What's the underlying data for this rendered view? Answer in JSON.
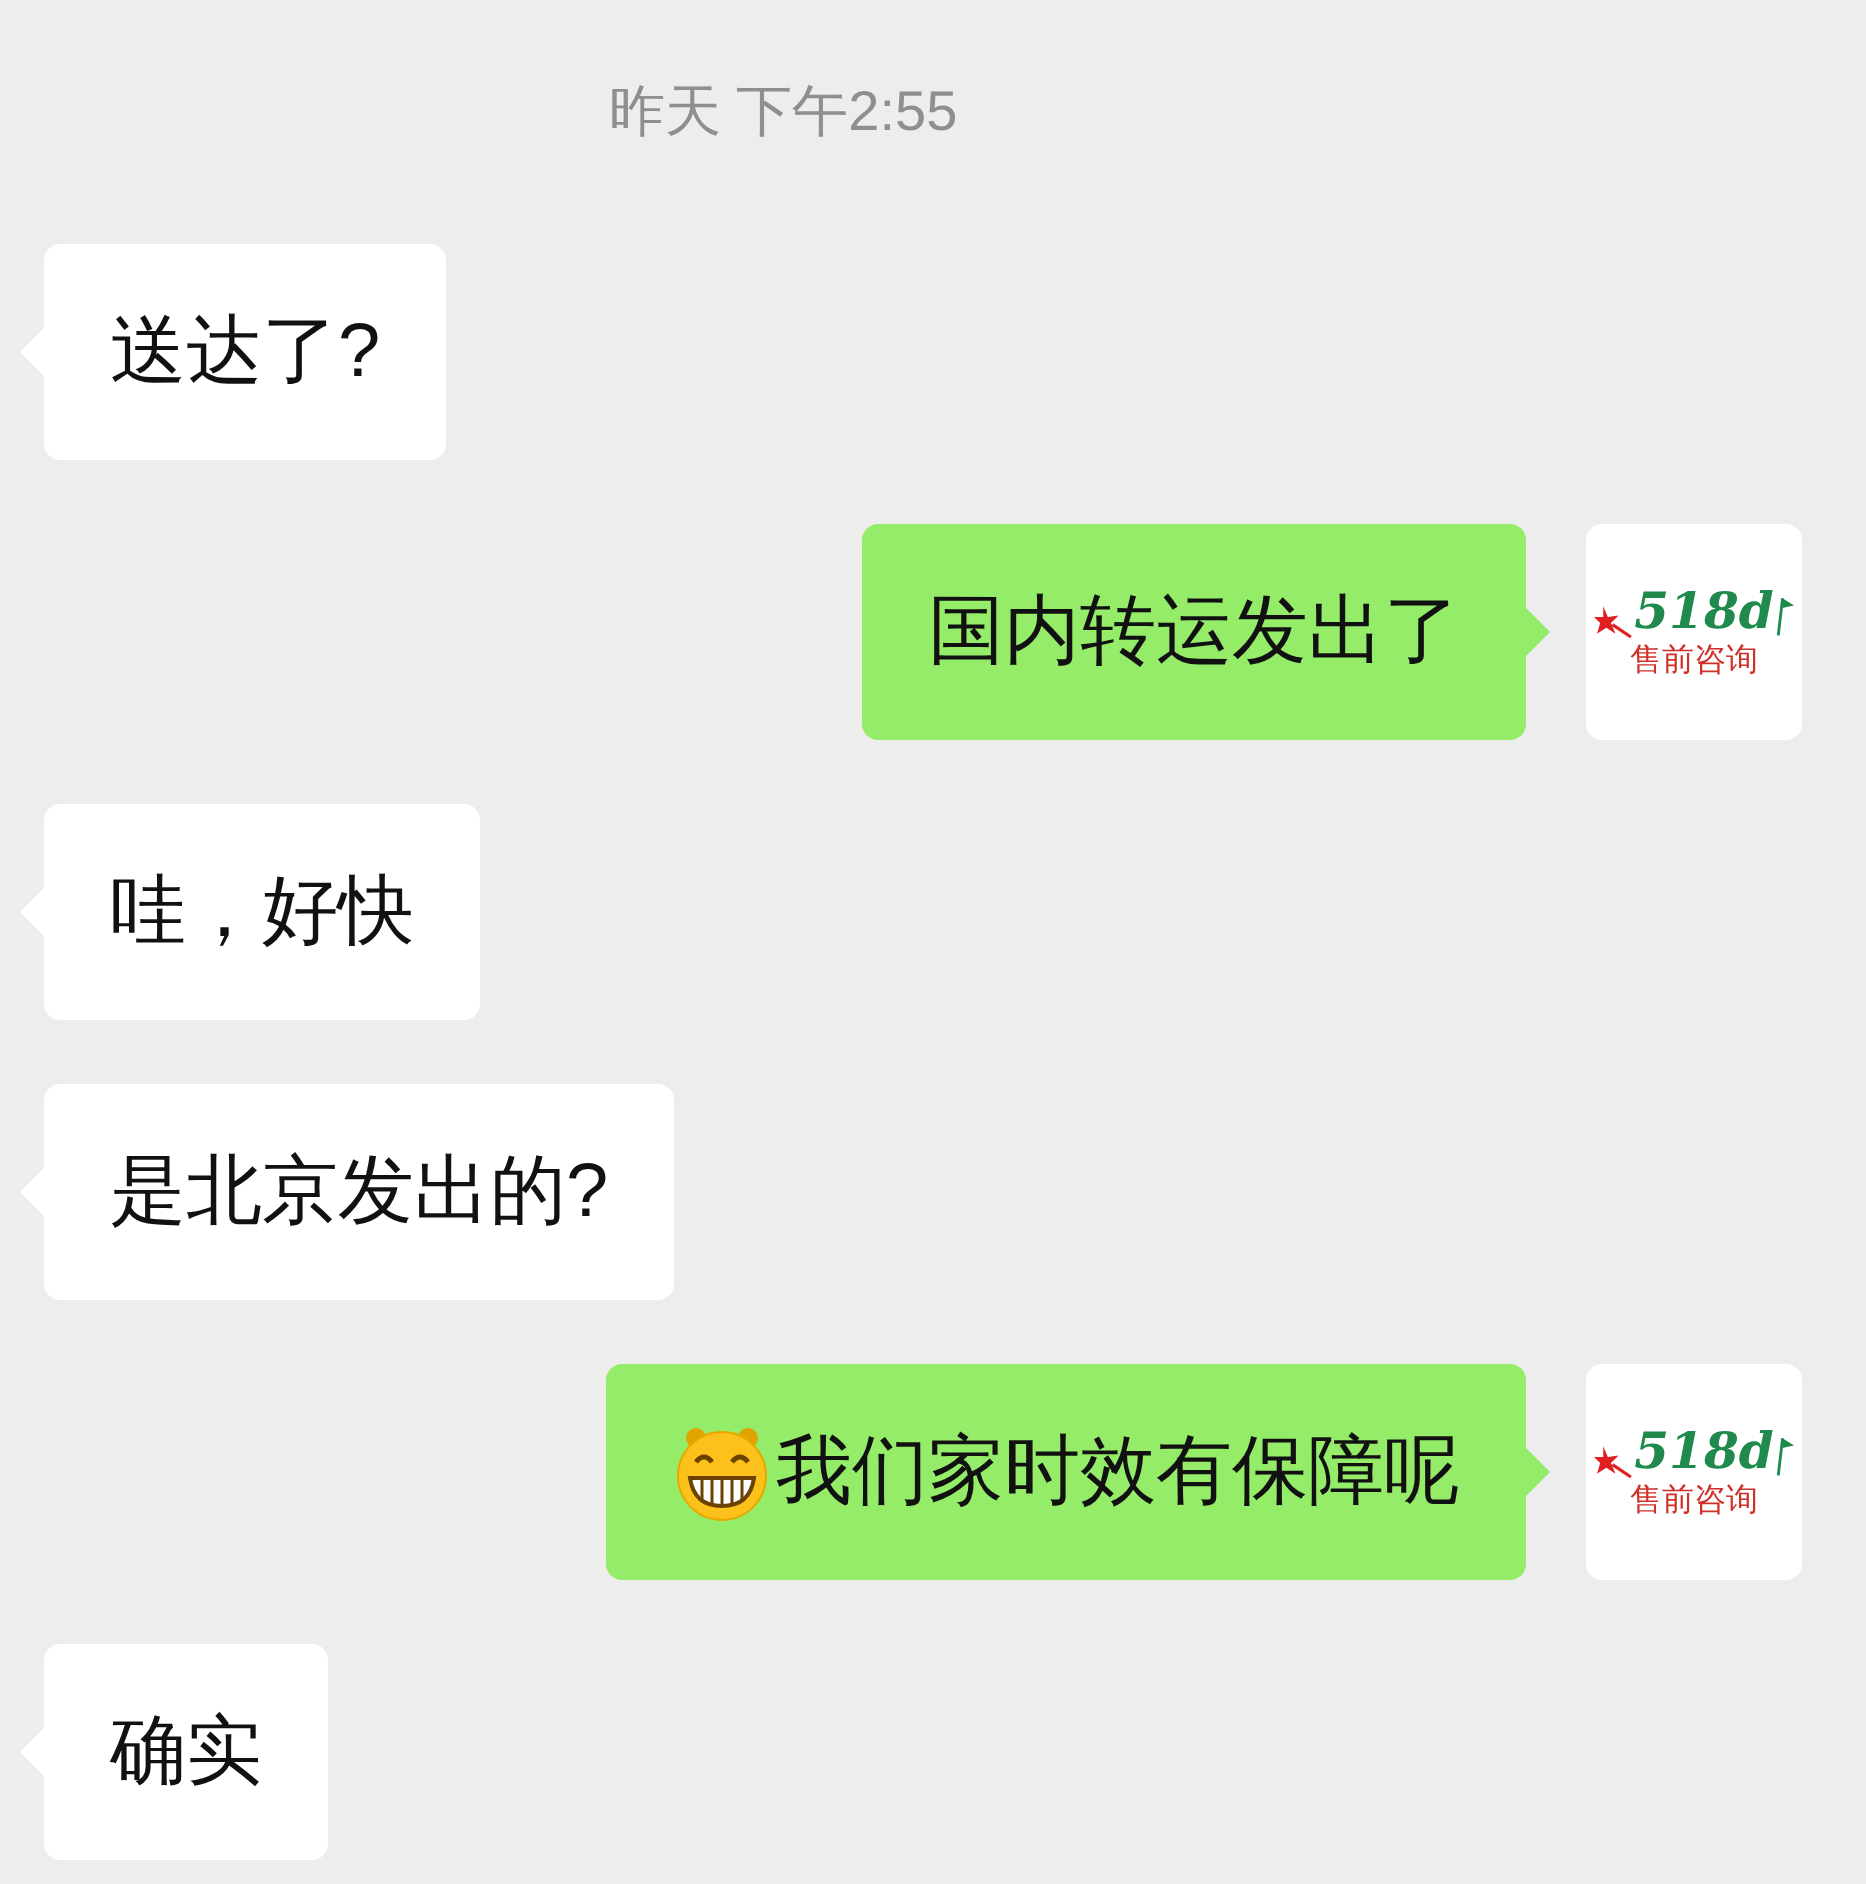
{
  "timestamp": "昨天 下午2:55",
  "messages": [
    {
      "outgoing": false,
      "kind": "text",
      "text": "送达了?"
    },
    {
      "outgoing": true,
      "kind": "text",
      "text": "国内转运发出了",
      "avatar": {
        "logo_text": "518d",
        "caption": "售前咨询"
      }
    },
    {
      "outgoing": false,
      "kind": "text",
      "text": "哇，好快"
    },
    {
      "outgoing": false,
      "kind": "text",
      "text": "是北京发出的?"
    },
    {
      "outgoing": true,
      "kind": "emoji_text",
      "text": "我们家时效有保障呢",
      "avatar": {
        "logo_text": "518d",
        "caption": "售前咨询"
      }
    },
    {
      "outgoing": false,
      "kind": "text",
      "text": "确实"
    }
  ]
}
